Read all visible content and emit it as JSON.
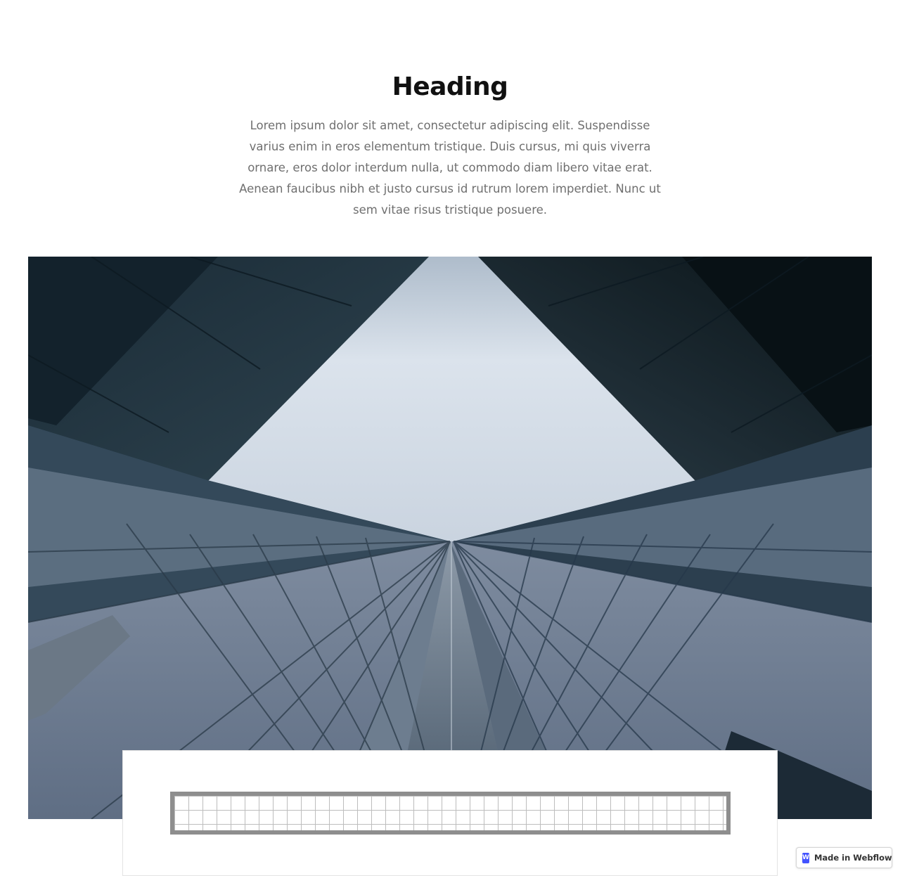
{
  "hero": {
    "heading": "Heading",
    "paragraph": "Lorem ipsum dolor sit amet, consectetur adipiscing elit. Suspendisse varius enim in eros elementum tristique. Duis cursus, mi quis viverra ornare, eros dolor interdum nulla, ut commodo diam libero vitae erat. Aenean faucibus nibh et justo cursus id rutrum lorem imperdiet. Nunc ut sem vitae risus tristique posuere."
  },
  "badge": {
    "logo_letter": "W",
    "label": "Made in Webflow"
  },
  "colors": {
    "webflow_brand": "#4353ff",
    "heading": "#111111",
    "paragraph": "#6f6f6f"
  }
}
